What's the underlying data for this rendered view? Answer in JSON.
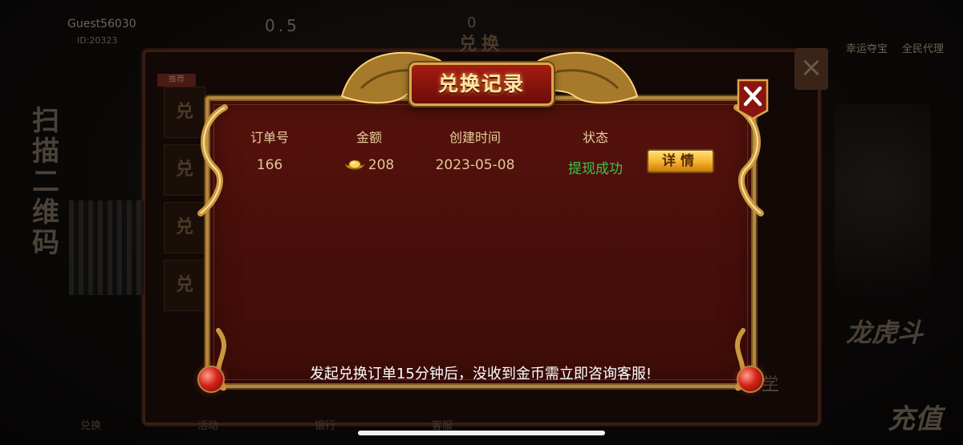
{
  "background": {
    "user_name": "Guest56030",
    "user_id": "ID:20323",
    "coin_balance": "0.5",
    "zero_value": "0",
    "window_title": "兑换",
    "right_links": [
      "幸运夺宝",
      "全民代理"
    ],
    "recommend_tag": "推荐",
    "tab_labels": [
      "兑",
      "兑",
      "兑",
      "兑"
    ],
    "side_text": [
      "扫",
      "描",
      "二",
      "维",
      "码"
    ],
    "bottom_nav": [
      "兑换",
      "活动",
      "银行",
      "客服"
    ],
    "recharge_label": "充值",
    "promo_text": "龙虎斗",
    "study_link": "学"
  },
  "modal": {
    "title": "兑换记录",
    "columns": {
      "order_no": "订单号",
      "amount": "金额",
      "created_time": "创建时间",
      "status": "状态"
    },
    "rows": [
      {
        "order_no": "166",
        "amount": "208",
        "created_time": "2023-05-08",
        "status": "提现成功",
        "detail_label": "详情"
      }
    ],
    "footer_note": "发起兑换订单15分钟后，没收到金币需立即咨询客服!"
  },
  "colors": {
    "panel_red": "#4a0f0a",
    "gold": "#d9a84a",
    "status_success": "#39c54a",
    "detail_button": "#f5b22a"
  },
  "icons": {
    "close": "close-icon",
    "amount": "gold-ingot-icon",
    "dragon": "dragon-ornament",
    "gem": "red-gem-ornament"
  }
}
